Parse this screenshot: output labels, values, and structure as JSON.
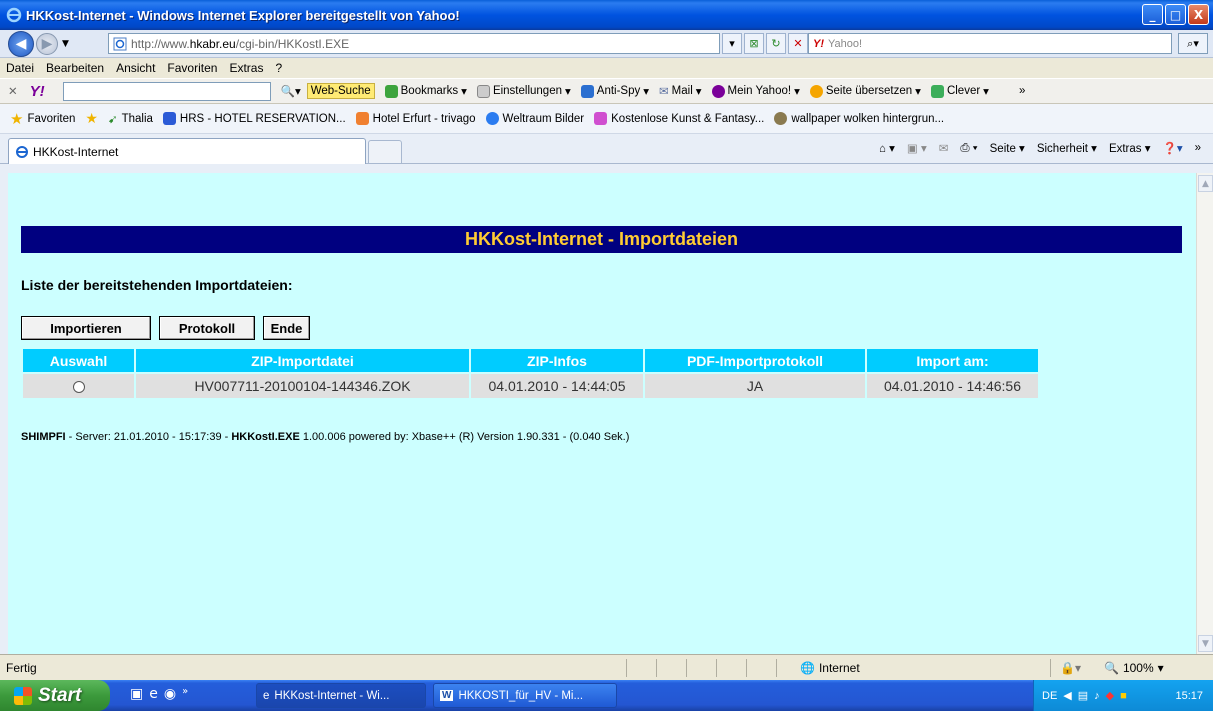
{
  "window": {
    "title": "HKKost-Internet - Windows Internet Explorer bereitgestellt von Yahoo!",
    "buttons": [
      "_",
      "□",
      "X"
    ]
  },
  "address": {
    "url_prefix": "http://www.",
    "url_host": "hkabr.eu",
    "url_path": "/cgi-bin/HKKostI.EXE",
    "search_placeholder": "Yahoo!",
    "search_brand": "Y!"
  },
  "menu": [
    "Datei",
    "Bearbeiten",
    "Ansicht",
    "Favoriten",
    "Extras",
    "?"
  ],
  "yahoo_toolbar": {
    "web_search": "Web-Suche",
    "bookmarks": "Bookmarks",
    "settings": "Einstellungen",
    "antispy": "Anti-Spy",
    "mail": "Mail",
    "mein_yahoo": "Mein Yahoo!",
    "translate": "Seite übersetzen",
    "clever": "Clever"
  },
  "favorites": {
    "label": "Favoriten",
    "items": [
      "Thalia",
      "HRS - HOTEL RESERVATION...",
      "Hotel Erfurt - trivago",
      "Weltraum Bilder",
      "Kostenlose Kunst & Fantasy...",
      "wallpaper wolken hintergrun..."
    ]
  },
  "tab": {
    "label": "HKKost-Internet"
  },
  "command_bar": {
    "seite": "Seite",
    "sicherheit": "Sicherheit",
    "extras": "Extras"
  },
  "page": {
    "banner": "HKKost-Internet - Importdateien",
    "subheading": "Liste der bereitstehenden Importdateien:",
    "buttons": {
      "import": "Importieren",
      "protocol": "Protokoll",
      "end": "Ende"
    },
    "table": {
      "headers": [
        "Auswahl",
        "ZIP-Importdatei",
        "ZIP-Infos",
        "PDF-Importprotokoll",
        "Import am:"
      ],
      "rows": [
        {
          "file": "HV007711-20100104-144346.ZOK",
          "zip_info": "04.01.2010 - 14:44:05",
          "pdf": "JA",
          "import_at": "04.01.2010 - 14:46:56"
        }
      ]
    },
    "footer": {
      "server_name": "SHIMPFI",
      "server_text": " - Server: 21.01.2010 - 15:17:39 - ",
      "exe": "HKKostI.EXE",
      "rest": " 1.00.006 powered by: Xbase++ (R) Version 1.90.331 - (0.040 Sek.)"
    }
  },
  "status": {
    "text": "Fertig",
    "zone": "Internet",
    "zoom": "100%"
  },
  "taskbar": {
    "start": "Start",
    "tasks": [
      "HKKost-Internet - Wi...",
      "HKKOSTI_für_HV - Mi..."
    ],
    "lang": "DE",
    "clock": "15:17"
  }
}
